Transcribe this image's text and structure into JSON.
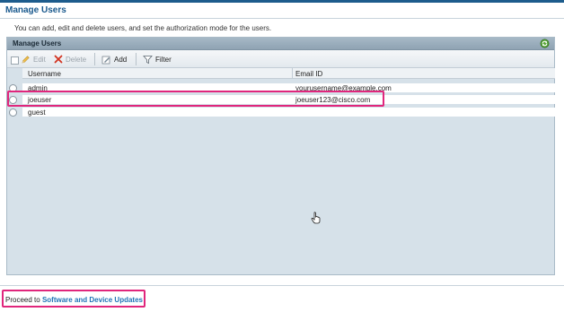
{
  "page": {
    "title": "Manage Users",
    "description": "You can add, edit and delete users, and set the authorization mode for the users."
  },
  "panel": {
    "title": "Manage Users",
    "refresh_icon": "refresh-icon"
  },
  "toolbar": {
    "edit_label": "Edit",
    "delete_label": "Delete",
    "add_label": "Add",
    "filter_label": "Filter"
  },
  "table": {
    "columns": [
      "Username",
      "Email ID"
    ],
    "rows": [
      {
        "username": "admin",
        "email": "yourusername@example.com"
      },
      {
        "username": "joeuser",
        "email": "joeuser123@cisco.com"
      },
      {
        "username": "guest",
        "email": ""
      }
    ]
  },
  "footer": {
    "prefix": "Proceed to",
    "link": "Software and Device Updates"
  },
  "colors": {
    "accent": "#1a5a8e",
    "highlight": "#e0267c",
    "link": "#1f73b7"
  }
}
